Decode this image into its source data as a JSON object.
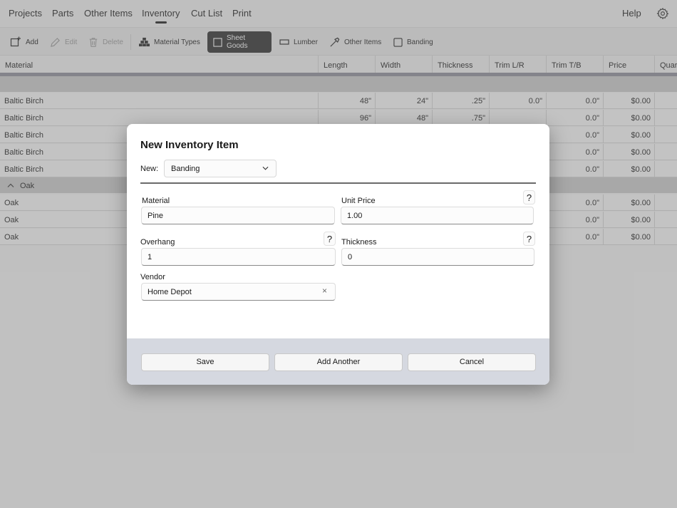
{
  "menu": {
    "items": [
      "Projects",
      "Parts",
      "Other Items",
      "Inventory",
      "Cut List",
      "Print"
    ],
    "help": "Help",
    "active": "Inventory"
  },
  "toolbar": {
    "add": "Add",
    "edit": "Edit",
    "delete": "Delete",
    "material_types": "Material Types",
    "sheet_goods": "Sheet Goods",
    "lumber": "Lumber",
    "other_items": "Other Items",
    "banding": "Banding"
  },
  "grid": {
    "columns": [
      "Material",
      "Length",
      "Width",
      "Thickness",
      "Trim L/R",
      "Trim T/B",
      "Price",
      "Quar"
    ],
    "rows_group1": [
      [
        "Baltic Birch",
        "48\"",
        "24\"",
        ".25\"",
        "0.0\"",
        "0.0\"",
        "$0.00"
      ],
      [
        "Baltic Birch",
        "96\"",
        "48\"",
        ".75\"",
        "",
        "0.0\"",
        "$0.00"
      ],
      [
        "Baltic Birch",
        "",
        "",
        "",
        "",
        "0.0\"",
        "$0.00"
      ],
      [
        "Baltic Birch",
        "",
        "",
        "",
        "",
        "0.0\"",
        "$0.00"
      ],
      [
        "Baltic Birch",
        "",
        "",
        "",
        "",
        "0.0\"",
        "$0.00"
      ]
    ],
    "group2_label": "Oak",
    "rows_group2": [
      [
        "Oak",
        "",
        "",
        "",
        "",
        "0.0\"",
        "$0.00"
      ],
      [
        "Oak",
        "",
        "",
        "",
        "",
        "0.0\"",
        "$0.00"
      ],
      [
        "Oak",
        "",
        "",
        "",
        "",
        "0.0\"",
        "$0.00"
      ]
    ]
  },
  "dialog": {
    "title": "New Inventory Item",
    "new_label": "New:",
    "new_value": "Banding",
    "material_label": "Material",
    "material_value": "Pine",
    "unit_price_label": "Unit Price",
    "unit_price_value": "1.00",
    "overhang_label": "Overhang",
    "overhang_value": "1",
    "thickness_label": "Thickness",
    "thickness_value": "0",
    "vendor_label": "Vendor",
    "vendor_value": "Home Depot",
    "help_glyph": "?",
    "clear_glyph": "×",
    "save": "Save",
    "add_another": "Add Another",
    "cancel": "Cancel"
  }
}
